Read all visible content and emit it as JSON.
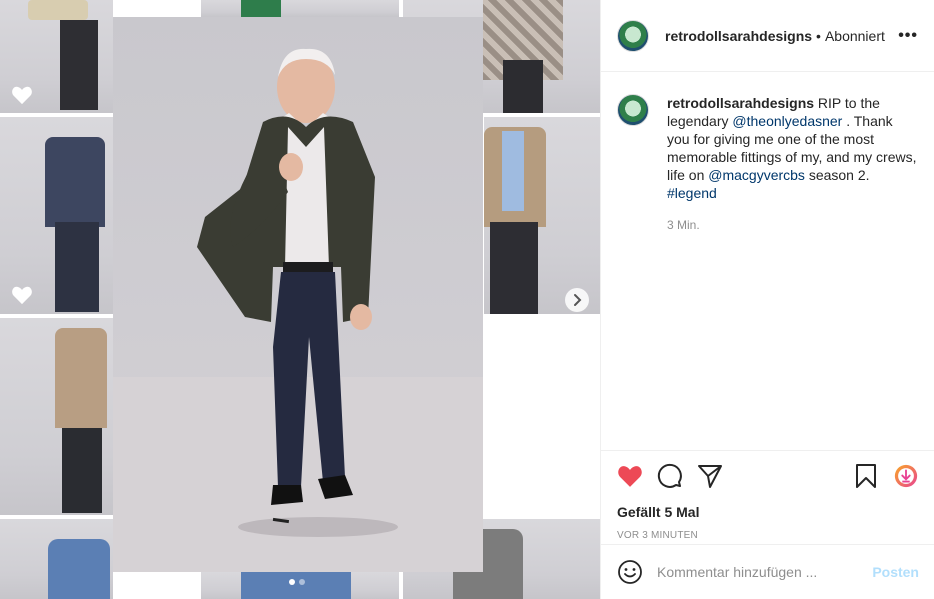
{
  "post": {
    "username": "retrodollsarahdesigns",
    "separator": "•",
    "follow_status": "Abonniert",
    "more_icon": "more-horizontal-icon"
  },
  "caption": {
    "username": "retrodollsarahdesigns",
    "text_1": " RIP to the legendary ",
    "mention_1": "@theonlyedasner",
    "text_2": " . Thank you for giving me one of the most memorable fittings of my, and my crews, life on ",
    "mention_2": "@macgyvercbs",
    "text_3": " season 2. ",
    "hashtag": "#legend",
    "time": "3 Min."
  },
  "actions": {
    "liked": true,
    "like_color": "#ed4956",
    "icons": [
      "heart-icon",
      "comment-icon",
      "share-icon",
      "bookmark-icon",
      "download-icon"
    ]
  },
  "likes": "Gefällt 5 Mal",
  "posted_ago": "VOR 3 MINUTEN",
  "comment": {
    "placeholder": "Kommentar hinzufügen ...",
    "post_label": "Posten"
  },
  "carousel": {
    "current": 1,
    "total": 2
  }
}
